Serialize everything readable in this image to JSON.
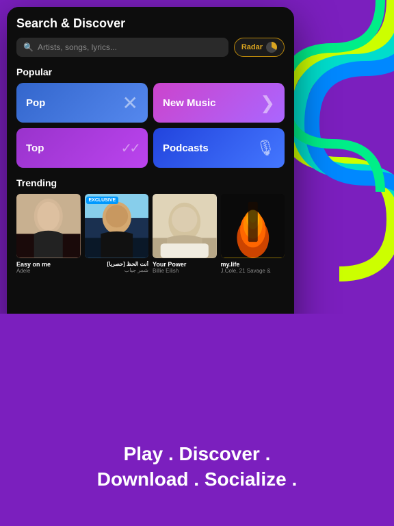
{
  "app": {
    "header": "Search & Discover",
    "search_placeholder": "Artists, songs, lyrics...",
    "radar_label": "Radar"
  },
  "popular": {
    "section_title": "Popular",
    "categories": [
      {
        "id": "pop",
        "label": "Pop",
        "icon": "✕",
        "style": "cat-pop"
      },
      {
        "id": "new-music",
        "label": "New Music",
        "icon": "❯",
        "style": "cat-newmusic"
      },
      {
        "id": "top",
        "label": "Top",
        "icon": "✓✓",
        "style": "cat-top"
      },
      {
        "id": "podcasts",
        "label": "Podcasts",
        "icon": "🎙",
        "style": "cat-podcasts"
      }
    ]
  },
  "trending": {
    "section_title": "Trending",
    "items": [
      {
        "id": "easy-on-me",
        "name": "Easy on me",
        "artist": "Adele",
        "thumb_class": "adele-face",
        "exclusive": false
      },
      {
        "id": "ant-alhaz",
        "name": "أنت الحظ [حصريا]",
        "artist": "شمر جياب",
        "thumb_class": "arabic-photo",
        "exclusive": true
      },
      {
        "id": "your-power",
        "name": "Your Power",
        "artist": "Billie Eilish",
        "thumb_class": "billie-face",
        "exclusive": false
      },
      {
        "id": "my-life",
        "name": "my.life",
        "artist": "J.Cole, 21 Savage &",
        "thumb_class": "fire-scene",
        "exclusive": false
      }
    ]
  },
  "tagline": {
    "line1": "Play . Discover .",
    "line2": "Download . Socialize ."
  },
  "exclusive_badge": "EXCLUSIVE",
  "colors": {
    "bg_purple": "#7B1FBE",
    "arc_yellow": "#CCFF00",
    "arc_green": "#00FF88",
    "arc_teal": "#00DDCC",
    "arc_blue": "#0088FF",
    "arc_pink": "#FF00AA",
    "arc_magenta": "#FF00FF"
  }
}
